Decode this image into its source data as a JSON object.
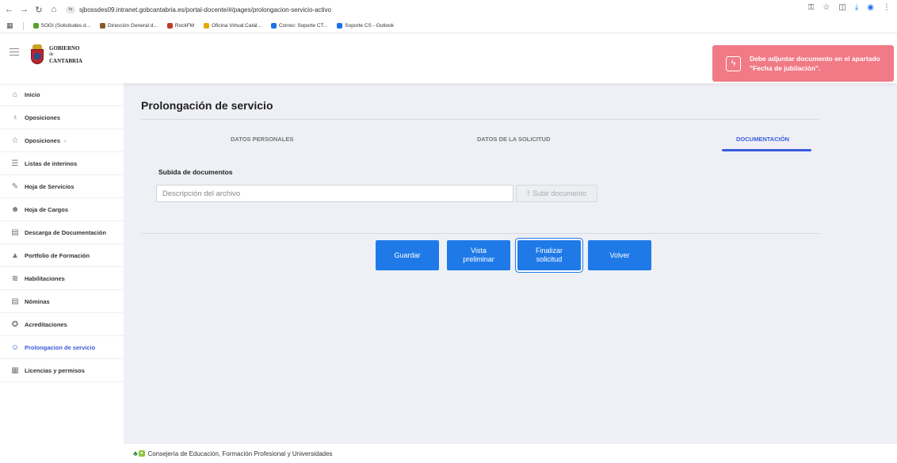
{
  "browser": {
    "url": "sjbossdes09.intranet.gobcantabria.es/portal-docente/#/pages/prolongacion-servicio-activo",
    "bookmarks": [
      {
        "label": "SOGI (Solicitudes d...",
        "color": "#5aa02c"
      },
      {
        "label": "Dirección General d...",
        "color": "#8b5a2b"
      },
      {
        "label": "RockFM",
        "color": "#c0392b"
      },
      {
        "label": "Oficina Virtual:Catál...",
        "color": "#e6a800"
      },
      {
        "label": "Correo: Soporte CT...",
        "color": "#1a73e8"
      },
      {
        "label": "Soporte CS - Outlook",
        "color": "#1a73e8"
      }
    ]
  },
  "header": {
    "logo_line1": "GOBIERNO",
    "logo_line2": "de",
    "logo_line3": "CANTABRIA"
  },
  "toast": {
    "line1": "Debe adjuntar documento en el apartado",
    "line2": "\"Fecha de jubilación\".",
    "color": "#f07a86"
  },
  "sidebar": {
    "items": [
      {
        "label": "Inicio",
        "icon": "home-icon"
      },
      {
        "label": "Oposiciones",
        "icon": "award-icon"
      },
      {
        "label": "Oposiciones",
        "icon": "star-icon"
      },
      {
        "label": "Listas de interinos",
        "icon": "list-icon"
      },
      {
        "label": "Hoja de Servicios",
        "icon": "wrench-icon"
      },
      {
        "label": "Hoja de Cargos",
        "icon": "user-group-icon"
      },
      {
        "label": "Descarga de Documentación",
        "icon": "document-icon"
      },
      {
        "label": "Portfolio de Formación",
        "icon": "graduation-cap-icon"
      },
      {
        "label": "Habilitaciones",
        "icon": "layers-icon"
      },
      {
        "label": "Nóminas",
        "icon": "document-icon"
      },
      {
        "label": "Acreditaciones",
        "icon": "medal-icon"
      },
      {
        "label": "Prolongacion de servicio",
        "icon": "user-plus-icon"
      },
      {
        "label": "Licencias y permisos",
        "icon": "calendar-icon"
      }
    ]
  },
  "main": {
    "title": "Prolongación de servicio",
    "tabs": [
      {
        "label": "DATOS PERSONALES"
      },
      {
        "label": "DATOS DE LA SOLICITUD"
      },
      {
        "label": "DOCUMENTACIÓN"
      }
    ],
    "upload_label": "Subida de documentos",
    "description_placeholder": "Descripción del archivo",
    "upload_button": "Subir documento",
    "buttons": {
      "save": "Guardar",
      "preview_l1": "Vista",
      "preview_l2": "preliminar",
      "finish_l1": "Finalizar",
      "finish_l2": "solicitud",
      "back": "Volver"
    },
    "accent_color": "#3b5bdb",
    "button_color": "#1f7ae8"
  },
  "footer": {
    "text": "Consejería de Educación, Formación Profesional y Universidades"
  }
}
